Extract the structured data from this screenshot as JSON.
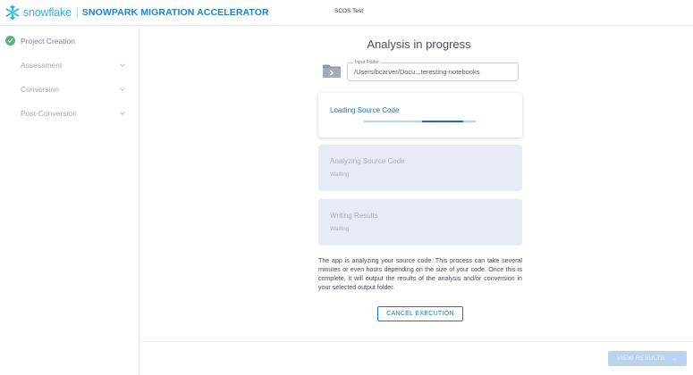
{
  "header": {
    "brand": "snowflake",
    "app_title": "SNOWPARK MIGRATION ACCELERATOR",
    "project_name": "SCOS Test"
  },
  "sidebar": {
    "items": [
      {
        "label": "Project Creation",
        "status": "complete",
        "icon": "check-circle-icon"
      },
      {
        "label": "Assessment",
        "icon": "chevron-down-icon"
      },
      {
        "label": "Conversion",
        "icon": "chevron-down-icon"
      },
      {
        "label": "Post-Conversion",
        "icon": "chevron-down-icon"
      }
    ]
  },
  "main": {
    "title": "Analysis in progress",
    "input_folder": {
      "label": "Input Folder",
      "value": "/Users/bcarver/Docu...teresting-notebooks",
      "icon": "folder-icon"
    },
    "steps": [
      {
        "title": "Loading Source Code",
        "status": "",
        "progress_fill": [
          0.52,
          0.89
        ]
      },
      {
        "title": "Analyzing Source Code",
        "status": "Waiting"
      },
      {
        "title": "Writing Results",
        "status": "Waiting"
      }
    ],
    "description": "The app is analyzing your source code. This process can take several minutes or even hours depending on the size of your code. Once this is complete, it will output the results of the analysis and/or conversion in your selected output folder.",
    "cancel_label": "CANCEL EXECUTION"
  },
  "footer": {
    "view_results_label": "VIEW RESULTS",
    "view_results_icon": "arrow-right-icon"
  },
  "colors": {
    "brand": "#29b5e8",
    "accent": "#1e74b8",
    "success": "#56b47f",
    "waiting_card": "#e6ebf5",
    "disabled_button": "#bad3ef"
  }
}
